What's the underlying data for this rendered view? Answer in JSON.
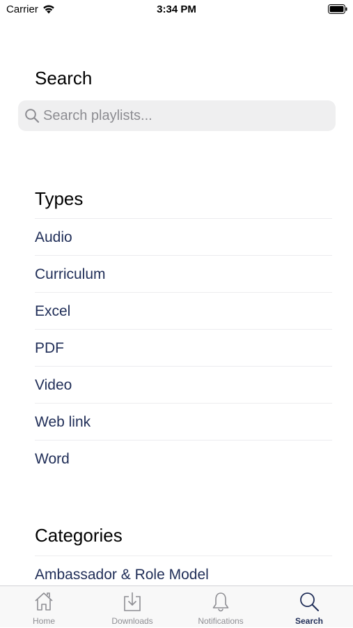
{
  "status_bar": {
    "carrier": "Carrier",
    "time": "3:34 PM"
  },
  "search": {
    "title": "Search",
    "placeholder": "Search playlists..."
  },
  "types": {
    "title": "Types",
    "items": [
      "Audio",
      "Curriculum",
      "Excel",
      "PDF",
      "Video",
      "Web link",
      "Word"
    ]
  },
  "categories": {
    "title": "Categories",
    "items": [
      "Ambassador & Role Model"
    ]
  },
  "tab_bar": {
    "tabs": [
      {
        "label": "Home",
        "icon": "home-icon"
      },
      {
        "label": "Downloads",
        "icon": "download-icon"
      },
      {
        "label": "Notifications",
        "icon": "bell-icon"
      },
      {
        "label": "Search",
        "icon": "search-icon"
      }
    ],
    "active": "Search",
    "active_color": "#1f2d57",
    "inactive_color": "#8e8e93"
  }
}
